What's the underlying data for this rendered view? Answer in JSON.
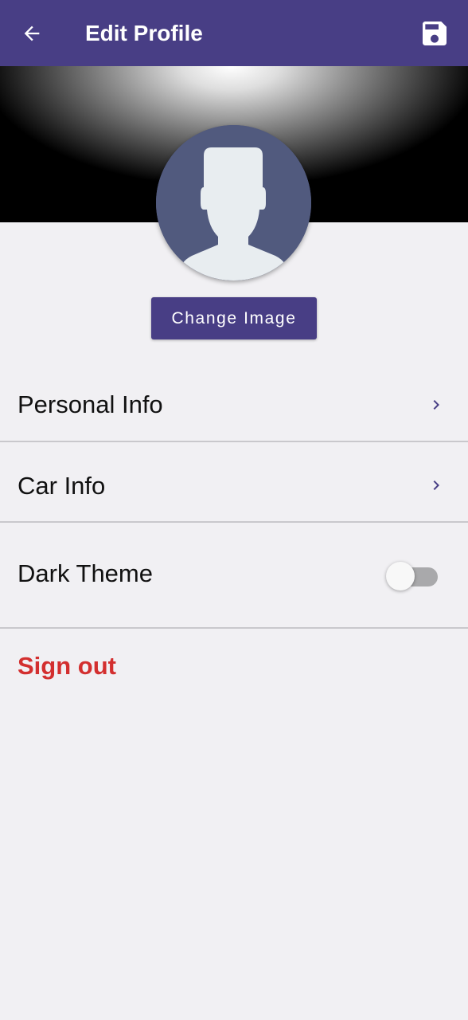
{
  "app_bar": {
    "title": "Edit Profile",
    "back_icon": "arrow-back-icon",
    "save_icon": "save-icon",
    "background_color": "#483e85"
  },
  "profile": {
    "avatar_icon": "default-person-avatar-icon",
    "change_image_label": "Change Image"
  },
  "settings": {
    "items": [
      {
        "label": "Personal Info",
        "trailing_icon": "chevron-right-icon"
      },
      {
        "label": "Car Info",
        "trailing_icon": "chevron-right-icon"
      },
      {
        "label": "Dark Theme",
        "control": "toggle",
        "enabled": false
      }
    ]
  },
  "sign_out": {
    "label": "Sign out",
    "color": "#d32f2f"
  },
  "colors": {
    "accent": "#483e85",
    "background": "#f1f0f3",
    "chevron": "#483e85"
  }
}
